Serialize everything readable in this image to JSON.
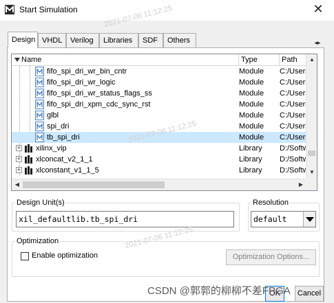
{
  "window": {
    "title": "Start Simulation",
    "close_glyph": "✕",
    "icon": "modelsim-m-icon"
  },
  "tabs": [
    {
      "label": "Design",
      "active": true
    },
    {
      "label": "VHDL",
      "active": false
    },
    {
      "label": "Verilog",
      "active": false
    },
    {
      "label": "Libraries",
      "active": false
    },
    {
      "label": "SDF",
      "active": false
    },
    {
      "label": "Others",
      "active": false
    }
  ],
  "tab_scroll_glyph": "◂▸",
  "library_list": {
    "columns": {
      "name": "Name",
      "type": "Type",
      "path": "Path"
    },
    "rows": [
      {
        "name": "fifo_spi_dri_wr_bin_cntr",
        "type": "Module",
        "path": "C:/Users",
        "kind": "module",
        "selected": false
      },
      {
        "name": "fifo_spi_dri_wr_logic",
        "type": "Module",
        "path": "C:/Users",
        "kind": "module",
        "selected": false
      },
      {
        "name": "fifo_spi_dri_wr_status_flags_ss",
        "type": "Module",
        "path": "C:/Users",
        "kind": "module",
        "selected": false
      },
      {
        "name": "fifo_spi_dri_xpm_cdc_sync_rst",
        "type": "Module",
        "path": "C:/Users",
        "kind": "module",
        "selected": false
      },
      {
        "name": "glbl",
        "type": "Module",
        "path": "C:/Users",
        "kind": "module",
        "selected": false
      },
      {
        "name": "spi_dri",
        "type": "Module",
        "path": "C:/Users",
        "kind": "module",
        "selected": false
      },
      {
        "name": "tb_spi_dri",
        "type": "Module",
        "path": "C:/Users",
        "kind": "module",
        "selected": true
      },
      {
        "name": "xilinx_vip",
        "type": "Library",
        "path": "D:/Softw",
        "kind": "library",
        "selected": false
      },
      {
        "name": "xlconcat_v2_1_1",
        "type": "Library",
        "path": "D:/Softw",
        "kind": "library",
        "selected": false
      },
      {
        "name": "xlconstant_v1_1_5",
        "type": "Library",
        "path": "D:/Softw",
        "kind": "library",
        "selected": false
      }
    ],
    "expander_glyph": "+",
    "scroll_up_glyph": "▲",
    "scroll_down_glyph": "▼",
    "scroll_left_glyph": "◀",
    "scroll_right_glyph": "▶"
  },
  "design_unit": {
    "label": "Design Unit(s)",
    "value": "xil_defaultlib.tb_spi_dri"
  },
  "resolution": {
    "label": "Resolution",
    "value": "default"
  },
  "optimization": {
    "label": "Optimization",
    "checkbox_label": "Enable optimization",
    "checked": false,
    "options_button": "Optimization Options..."
  },
  "footer": {
    "ok_label": "OK",
    "cancel_label": "Cancel"
  },
  "watermarks": {
    "csdn": "CSDN @郭郭的柳柳不差FPGA",
    "timestamp": "2021-07-06 11:12:25"
  },
  "colors": {
    "selection": "#cce8ff",
    "focus_border": "#0078d7",
    "module_icon": "#4a7fbf"
  }
}
